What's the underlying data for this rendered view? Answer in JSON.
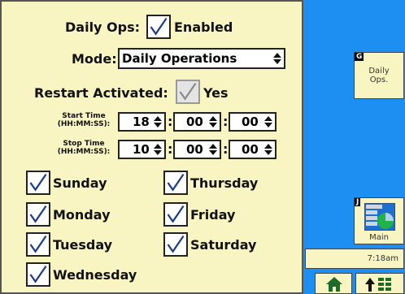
{
  "daily_ops": {
    "label": "Daily Ops:",
    "checked": true,
    "value_label": "Enabled"
  },
  "mode": {
    "label": "Mode:",
    "value": "Daily Operations"
  },
  "restart": {
    "label": "Restart Activated:",
    "checked": true,
    "value_label": "Yes"
  },
  "start_time": {
    "label_line1": "Start Time",
    "label_line2": "(HH:MM:SS):",
    "hh": "18",
    "mm": "00",
    "ss": "00"
  },
  "stop_time": {
    "label_line1": "Stop Time",
    "label_line2": "(HH:MM:SS):",
    "hh": "10",
    "mm": "00",
    "ss": "00"
  },
  "time_separator": ":",
  "days": {
    "sunday": "Sunday",
    "monday": "Monday",
    "tuesday": "Tuesday",
    "wednesday": "Wednesday",
    "thursday": "Thursday",
    "friday": "Friday",
    "saturday": "Saturday"
  },
  "sidebar": {
    "daily_ops_button": {
      "letter": "G",
      "line1": "Daily",
      "line2": "Ops."
    },
    "main_button": {
      "letter": "J",
      "label": "Main"
    },
    "clock": "7:18am"
  },
  "colors": {
    "panel_bg": "#f9f5c2",
    "sidebar_bg": "#1d8ff2",
    "checkmark": "#1a3a8c"
  }
}
